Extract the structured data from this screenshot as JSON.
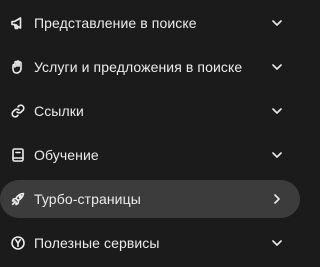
{
  "menu": {
    "items": [
      {
        "label": "Представление в поиске",
        "icon": "megaphone-icon",
        "chevron": "chevron-down-icon",
        "active": false
      },
      {
        "label": "Услуги и предложения в поиске",
        "icon": "hand-icon",
        "chevron": "chevron-down-icon",
        "active": false
      },
      {
        "label": "Ссылки",
        "icon": "link-icon",
        "chevron": "chevron-down-icon",
        "active": false
      },
      {
        "label": "Обучение",
        "icon": "book-icon",
        "chevron": "chevron-down-icon",
        "active": false
      },
      {
        "label": "Турбо-страницы",
        "icon": "rocket-icon",
        "chevron": "chevron-right-icon",
        "active": true
      },
      {
        "label": "Полезные сервисы",
        "icon": "yandex-icon",
        "chevron": "chevron-down-icon",
        "active": false
      }
    ]
  },
  "colors": {
    "background": "#1b1b1b",
    "active_background": "#3c3c3c",
    "text": "#ececec"
  }
}
